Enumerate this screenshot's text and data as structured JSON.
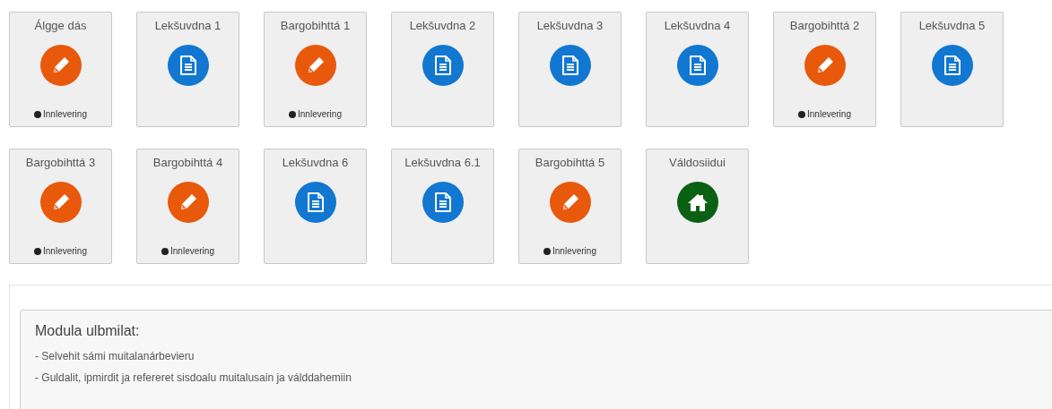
{
  "tiles": [
    {
      "title": "Álgge dás",
      "kind": "assignment",
      "status": "Innlevering"
    },
    {
      "title": "Lekšuvdna 1",
      "kind": "document"
    },
    {
      "title": "Bargobihttá 1",
      "kind": "assignment",
      "status": "Innlevering"
    },
    {
      "title": "Lekšuvdna 2",
      "kind": "document"
    },
    {
      "title": "Lekšuvdna 3",
      "kind": "document"
    },
    {
      "title": "Lekšuvdna 4",
      "kind": "document"
    },
    {
      "title": "Bargobihttá 2",
      "kind": "assignment",
      "status": "Innlevering"
    },
    {
      "title": "Lekšuvdna 5",
      "kind": "document"
    },
    {
      "title": "Bargobihttá 3",
      "kind": "assignment",
      "status": "Innlevering"
    },
    {
      "title": "Bargobihttá 4",
      "kind": "assignment",
      "status": "Innlevering"
    },
    {
      "title": "Lekšuvdna 6",
      "kind": "document"
    },
    {
      "title": "Lekšuvdna 6.1",
      "kind": "document"
    },
    {
      "title": "Bargobihttá 5",
      "kind": "assignment",
      "status": "Innlevering"
    },
    {
      "title": "Váldosiidui",
      "kind": "home"
    }
  ],
  "module_goals": {
    "heading": "Modula ulbmilat:",
    "items": [
      "- Selvehit sámi muitalanárbevieru",
      "- Guldalit, ipmirdit ja refereret sisdoalu muitalusain ja válddahemiin"
    ]
  }
}
